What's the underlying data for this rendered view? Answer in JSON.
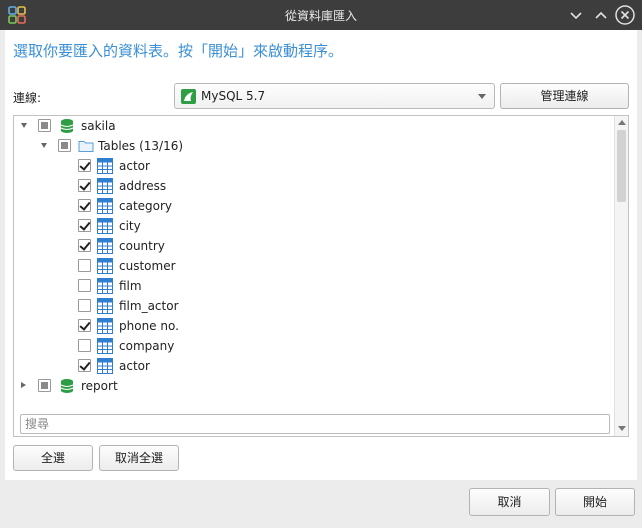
{
  "window": {
    "title": "從資料庫匯入",
    "icon": "navicat-app-icon"
  },
  "instruction": "選取你要匯入的資料表。按「開始」來啟動程序。",
  "connection": {
    "label": "連線:",
    "selected": "MySQL 5.7",
    "manage_label": "管理連線"
  },
  "tree": {
    "databases": [
      {
        "name": "sakila",
        "state": "partial",
        "expanded": true,
        "group": {
          "label": "Tables (13/16)",
          "state": "partial",
          "tables": [
            {
              "name": "actor",
              "checked": true
            },
            {
              "name": "address",
              "checked": true
            },
            {
              "name": "category",
              "checked": true
            },
            {
              "name": "city",
              "checked": true
            },
            {
              "name": "country",
              "checked": true
            },
            {
              "name": "customer",
              "checked": false
            },
            {
              "name": "film",
              "checked": false
            },
            {
              "name": "film_actor",
              "checked": false
            },
            {
              "name": "phone no.",
              "checked": true
            },
            {
              "name": "company",
              "checked": false
            },
            {
              "name": "actor",
              "checked": true
            }
          ]
        }
      },
      {
        "name": "report",
        "state": "partial",
        "expanded": false
      }
    ]
  },
  "search": {
    "placeholder": "搜尋",
    "value": ""
  },
  "buttons": {
    "select_all": "全選",
    "deselect_all": "取消全選",
    "cancel": "取消",
    "start": "開始"
  },
  "colors": {
    "accent": "#3a8fd6",
    "titlebar": "#3d3d3d",
    "database_icon": "#2e9e44",
    "table_icon": "#2f7fd0"
  }
}
